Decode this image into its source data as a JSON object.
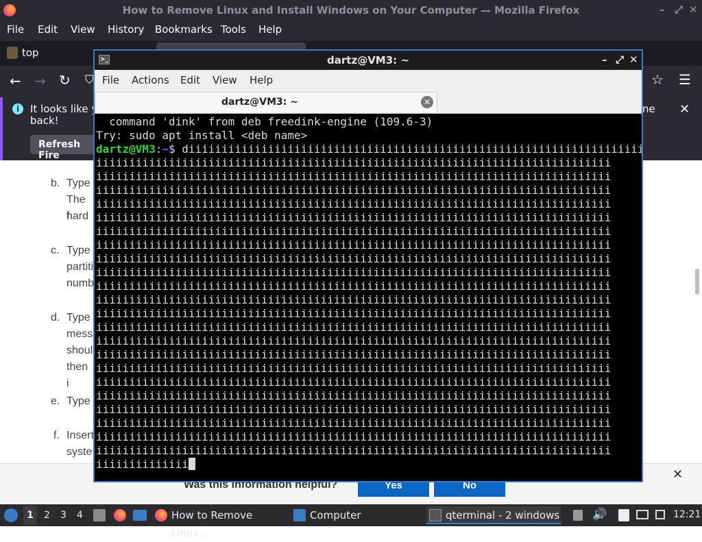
{
  "firefox": {
    "title": "How to Remove Linux and Install Windows on Your Computer — Mozilla Firefox",
    "menu": [
      "File",
      "Edit",
      "View",
      "History",
      "Bookmarks",
      "Tools",
      "Help"
    ],
    "tab_label": "top",
    "notice": {
      "text_line1": "It looks like y",
      "text_line1_tail": "ne",
      "text_line2": "back!",
      "refresh_button": "Refresh Fire"
    },
    "content": {
      "items": [
        {
          "marker": "b.",
          "lines": [
            "Type",
            "The f",
            "hard"
          ]
        },
        {
          "marker": "c.",
          "lines": [
            "Type",
            "partiti",
            "numb"
          ]
        },
        {
          "marker": "d.",
          "lines": [
            "Type",
            "mess",
            "shoul",
            "then i"
          ]
        },
        {
          "marker": "e.",
          "lines": [
            "Type"
          ]
        },
        {
          "marker": "f.",
          "lines": [
            "Insert",
            "syste"
          ]
        }
      ]
    },
    "helpful": {
      "question": "Was this information helpful?",
      "yes": "Yes",
      "no": "No"
    }
  },
  "terminal": {
    "title": "dartz@VM3: ~",
    "menu": [
      "File",
      "Actions",
      "Edit",
      "View",
      "Help"
    ],
    "tab_label": "dartz@VM3: ~",
    "lines": [
      "  command 'dink' from deb freedink-engine (109.6-3)",
      "Try: sudo apt install <deb name>"
    ],
    "prompt_user": "dartz@VM3",
    "prompt_sep": ":",
    "prompt_path": "~",
    "prompt_symbol": "$ ",
    "command_first": "diiiiiiiiiiiiiiiiiiiiiiiiiiiiiiiiiiiiiiiiiiiiiiiiiiiiiiiiiiiiiiiiiiiiiii",
    "command_wrap_line": "iiiiiiiiiiiiiiiiiiiiiiiiiiiiiiiiiiiiiiiiiiiiiiiiiiiiiiiiiiiiiiiiiiiiiiiiiiiiii",
    "command_last": "iiiiiiiiiiiiii"
  },
  "taskbar": {
    "workspaces": [
      "1",
      "2",
      "3",
      "4"
    ],
    "tasks": [
      {
        "label": "How to Remove Linux..."
      },
      {
        "label": "Computer"
      },
      {
        "label": "qterminal - 2 windows"
      }
    ],
    "clock": "12:21"
  },
  "colors": {
    "accent": "#3d7bc6",
    "firefox_purple": "#9059ff",
    "helpful_button": "#0a66c2"
  }
}
